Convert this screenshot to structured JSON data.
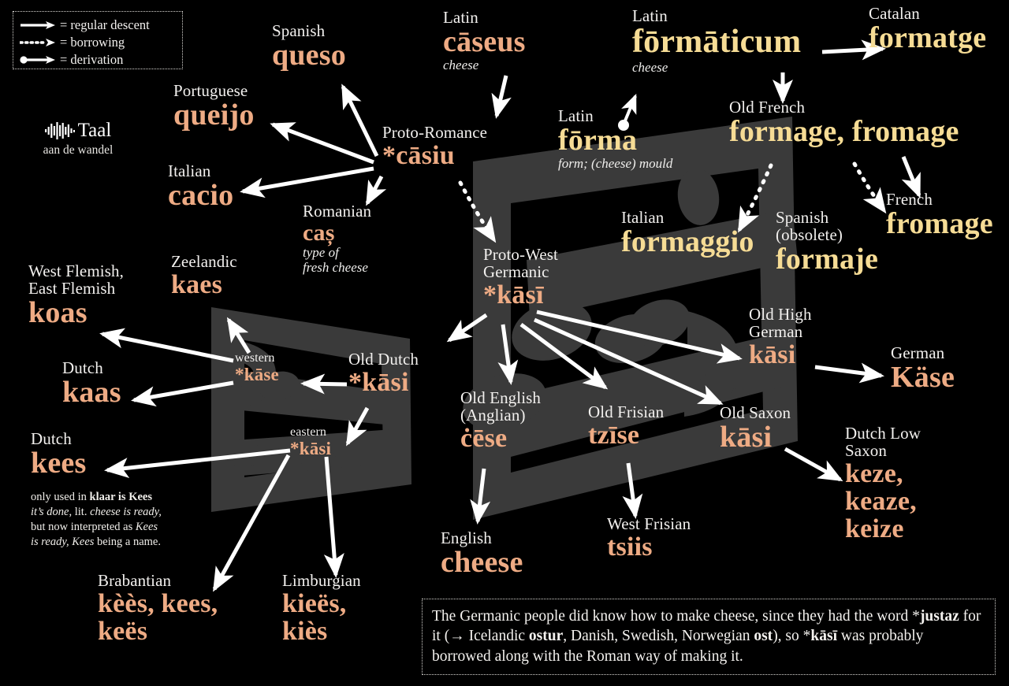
{
  "colors": {
    "background": "#000000",
    "caseus_branch": "#eeab84",
    "forma_branch": "#f6dc95",
    "label_text": "#f2f0ee",
    "watermark": "#3a3a3a"
  },
  "legend": {
    "title": "legend",
    "items": [
      {
        "icon": "solid-arrow-icon",
        "label": "= regular descent"
      },
      {
        "icon": "dotted-arrow-icon",
        "label": "= borrowing"
      },
      {
        "icon": "dot-arrow-icon",
        "label": "= derivation"
      }
    ]
  },
  "brand": {
    "icon": "waveform-icon",
    "name": "Taal",
    "tagline": "aan de wandel"
  },
  "nodes": [
    {
      "id": "latin-caseus",
      "lang": "Latin",
      "word": "cāseus",
      "gloss": "cheese",
      "branch": "caseus"
    },
    {
      "id": "proto-romance",
      "lang": "Proto-Romance",
      "word": "*cāsiu",
      "gloss": "",
      "branch": "caseus"
    },
    {
      "id": "spanish-queso",
      "lang": "Spanish",
      "word": "queso",
      "gloss": "",
      "branch": "caseus"
    },
    {
      "id": "portuguese",
      "lang": "Portuguese",
      "word": "queijo",
      "gloss": "",
      "branch": "caseus"
    },
    {
      "id": "italian-cacio",
      "lang": "Italian",
      "word": "cacio",
      "gloss": "",
      "branch": "caseus"
    },
    {
      "id": "romanian",
      "lang": "Romanian",
      "word": "caș",
      "gloss": "type of\nfresh cheese",
      "branch": "caseus"
    },
    {
      "id": "latin-forma",
      "lang": "Latin",
      "word": "fōrma",
      "gloss": "form; (cheese) mould",
      "branch": "forma"
    },
    {
      "id": "latin-formaticum",
      "lang": "Latin",
      "word": "fōrmāticum",
      "gloss": "cheese",
      "branch": "forma"
    },
    {
      "id": "catalan",
      "lang": "Catalan",
      "word": "formatge",
      "gloss": "",
      "branch": "forma"
    },
    {
      "id": "old-french",
      "lang": "Old French",
      "word": "formage, fromage",
      "gloss": "",
      "branch": "forma"
    },
    {
      "id": "french",
      "lang": "French",
      "word": "fromage",
      "gloss": "",
      "branch": "forma"
    },
    {
      "id": "italian-formaggio",
      "lang": "Italian",
      "word": "formaggio",
      "gloss": "",
      "branch": "forma"
    },
    {
      "id": "spanish-formaje",
      "lang": "Spanish\n(obsolete)",
      "word": "formaje",
      "gloss": "",
      "branch": "forma"
    },
    {
      "id": "pwg",
      "lang": "Proto-West\nGermanic",
      "word": "*kāsī",
      "gloss": "",
      "branch": "caseus"
    },
    {
      "id": "old-dutch",
      "lang": "Old Dutch",
      "word": "*kāsi",
      "gloss": "",
      "branch": "caseus"
    },
    {
      "id": "western",
      "lang": "western",
      "word": "*kāse",
      "gloss": "",
      "branch": "caseus"
    },
    {
      "id": "eastern",
      "lang": "eastern",
      "word": "*kāsi",
      "gloss": "",
      "branch": "caseus"
    },
    {
      "id": "zeelandic",
      "lang": "Zeelandic",
      "word": "kaes",
      "gloss": "",
      "branch": "caseus"
    },
    {
      "id": "flemish",
      "lang": "West Flemish,\nEast Flemish",
      "word": "koas",
      "gloss": "",
      "branch": "caseus"
    },
    {
      "id": "dutch-kaas",
      "lang": "Dutch",
      "word": "kaas",
      "gloss": "",
      "branch": "caseus"
    },
    {
      "id": "dutch-kees",
      "lang": "Dutch",
      "word": "kees",
      "gloss": "",
      "branch": "caseus"
    },
    {
      "id": "brabantian",
      "lang": "Brabantian",
      "word": "kèès, kees,\nkeës",
      "gloss": "",
      "branch": "caseus"
    },
    {
      "id": "limburgian",
      "lang": "Limburgian",
      "word": "kieës,\nkiès",
      "gloss": "",
      "branch": "caseus"
    },
    {
      "id": "old-english",
      "lang": "Old English\n(Anglian)",
      "word": "ċēse",
      "gloss": "",
      "branch": "caseus"
    },
    {
      "id": "english",
      "lang": "English",
      "word": "cheese",
      "gloss": "",
      "branch": "caseus"
    },
    {
      "id": "old-frisian",
      "lang": "Old Frisian",
      "word": "tzīse",
      "gloss": "",
      "branch": "caseus"
    },
    {
      "id": "west-frisian",
      "lang": "West Frisian",
      "word": "tsiis",
      "gloss": "",
      "branch": "caseus"
    },
    {
      "id": "ohg",
      "lang": "Old High\nGerman",
      "word": "kāsi",
      "gloss": "",
      "branch": "caseus"
    },
    {
      "id": "german",
      "lang": "German",
      "word": "Käse",
      "gloss": "",
      "branch": "caseus"
    },
    {
      "id": "old-saxon",
      "lang": "Old Saxon",
      "word": "kāsi",
      "gloss": "",
      "branch": "caseus"
    },
    {
      "id": "dutch-low-saxon",
      "lang": "Dutch Low\nSaxon",
      "word": "keze,\nkeaze,\nkeize",
      "gloss": "",
      "branch": "caseus"
    }
  ],
  "labels": {
    "latin_caseus_lang": "Latin",
    "latin_caseus_word": "cāseus",
    "latin_caseus_gloss": "cheese",
    "proto_romance_lang": "Proto-Romance",
    "proto_romance_word": "*cāsiu",
    "spanish_lang": "Spanish",
    "spanish_word": "queso",
    "portuguese_lang": "Portuguese",
    "portuguese_word": "queijo",
    "italian_cacio_lang": "Italian",
    "italian_cacio_word": "cacio",
    "romanian_lang": "Romanian",
    "romanian_word": "caș",
    "romanian_gloss_1": "type of",
    "romanian_gloss_2": "fresh cheese",
    "latin_forma_lang": "Latin",
    "latin_forma_word": "fōrma",
    "latin_forma_gloss": "form; (cheese) mould",
    "latin_formaticum_lang": "Latin",
    "latin_formaticum_word": "fōrmāticum",
    "latin_formaticum_gloss": "cheese",
    "catalan_lang": "Catalan",
    "catalan_word": "formatge",
    "old_french_lang": "Old French",
    "old_french_word": "formage, fromage",
    "french_lang": "French",
    "french_word": "fromage",
    "italian_formaggio_lang": "Italian",
    "italian_formaggio_word": "formaggio",
    "spanish_obs_lang_1": "Spanish",
    "spanish_obs_lang_2": "(obsolete)",
    "spanish_obs_word": "formaje",
    "pwg_lang_1": "Proto-West",
    "pwg_lang_2": "Germanic",
    "pwg_word": "*kāsī",
    "old_dutch_lang": "Old Dutch",
    "old_dutch_word": "*kāsi",
    "western_lang": "western",
    "western_word": "*kāse",
    "eastern_lang": "eastern",
    "eastern_word": "*kāsi",
    "zeelandic_lang": "Zeelandic",
    "zeelandic_word": "kaes",
    "flemish_lang_1": "West Flemish,",
    "flemish_lang_2": "East Flemish",
    "flemish_word": "koas",
    "dutch_kaas_lang": "Dutch",
    "dutch_kaas_word": "kaas",
    "dutch_kees_lang": "Dutch",
    "dutch_kees_word": "kees",
    "brabantian_lang": "Brabantian",
    "brabantian_word_1": "kèès, kees,",
    "brabantian_word_2": "keës",
    "limburgian_lang": "Limburgian",
    "limburgian_word_1": "kieës,",
    "limburgian_word_2": "kiès",
    "old_english_lang_1": "Old English",
    "old_english_lang_2": "(Anglian)",
    "old_english_word": "ċēse",
    "english_lang": "English",
    "english_word": "cheese",
    "old_frisian_lang": "Old Frisian",
    "old_frisian_word": "tzīse",
    "west_frisian_lang": "West Frisian",
    "west_frisian_word": "tsiis",
    "ohg_lang_1": "Old High",
    "ohg_lang_2": "German",
    "ohg_word": "kāsi",
    "german_lang": "German",
    "german_word": "Käse",
    "old_saxon_lang": "Old Saxon",
    "old_saxon_word": "kāsi",
    "dls_lang_1": "Dutch Low",
    "dls_lang_2": "Saxon",
    "dls_word_1": "keze,",
    "dls_word_2": "keaze,",
    "dls_word_3": "keize"
  },
  "kees_note": {
    "line1_plain": "only used in ",
    "line1_bold": "klaar is Kees",
    "line2_italic": "it’s done",
    "line2_plain": ", lit. ",
    "line2_italic2": "cheese is ready,",
    "line3_plain": "but now interpreted as ",
    "line3_italic": "Kees",
    "line4_italic": "is ready,",
    "line4_italic2": " Kees",
    "line4_plain": " being a name."
  },
  "explanation": {
    "part1": "The Germanic people did know how to make cheese, since they had the word *",
    "bold1": "justaz",
    "part2": " for it (→ Icelandic ",
    "bold2": "ostur",
    "part3": ", Danish, Swedish, Norwegian ",
    "bold3": "ost",
    "part4": "), so *",
    "bold4": "kāsī",
    "part5": " was probably borrowed along with the Roman way of making it."
  }
}
